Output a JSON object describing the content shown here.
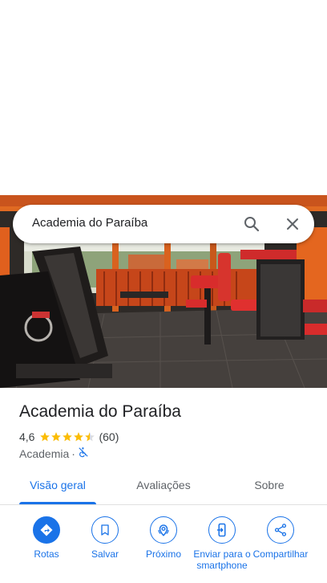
{
  "search": {
    "query": "Academia do Paraíba"
  },
  "place": {
    "name": "Academia do Paraíba",
    "rating": "4,6",
    "stars": 4.5,
    "reviews": "(60)",
    "category": "Academia",
    "separator": "·"
  },
  "tabs": [
    {
      "label": "Visão geral",
      "active": true
    },
    {
      "label": "Avaliações",
      "active": false
    },
    {
      "label": "Sobre",
      "active": false
    }
  ],
  "actions": [
    {
      "label": "Rotas",
      "icon": "directions-icon"
    },
    {
      "label": "Salvar",
      "icon": "bookmark-icon"
    },
    {
      "label": "Próximo",
      "icon": "nearby-icon"
    },
    {
      "label": "Enviar para o smartphone",
      "icon": "send-to-phone-icon"
    },
    {
      "label": "Compartilhar",
      "icon": "share-icon"
    }
  ],
  "colors": {
    "accent": "#1a73e8",
    "star": "#fbbc04"
  }
}
